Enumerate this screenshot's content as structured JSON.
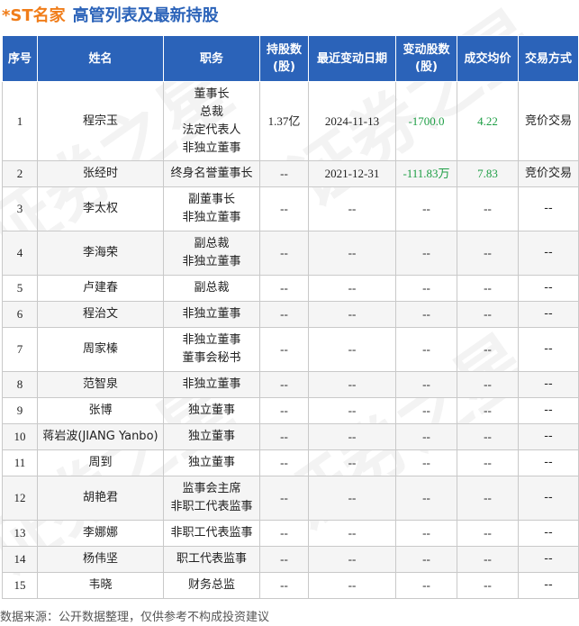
{
  "title": {
    "stock": "*ST名家",
    "main": "高管列表及最新持股"
  },
  "table": {
    "headers": {
      "idx": "序号",
      "name": "姓名",
      "position": "职务",
      "holding_l1": "持股数",
      "holding_l2": "(股)",
      "date": "最近变动日期",
      "change_l1": "变动股数",
      "change_l2": "(股)",
      "avg_price": "成交均价",
      "method": "交易方式"
    },
    "rows": [
      {
        "idx": "1",
        "name": "程宗玉",
        "duties": [
          "董事长",
          "总裁",
          "法定代表人",
          "非独立董事"
        ],
        "holding": "1.37亿",
        "date": "2024-11-13",
        "change": "-1700.0",
        "avg": "4.22",
        "method": "竞价交易"
      },
      {
        "idx": "2",
        "name": "张经时",
        "duties": [
          "终身名誉董事长"
        ],
        "holding": "--",
        "date": "2021-12-31",
        "change": "-111.83万",
        "avg": "7.83",
        "method": "竞价交易"
      },
      {
        "idx": "3",
        "name": "李太权",
        "duties": [
          "副董事长",
          "非独立董事"
        ],
        "holding": "--",
        "date": "--",
        "change": "--",
        "avg": "--",
        "method": "--"
      },
      {
        "idx": "4",
        "name": "李海荣",
        "duties": [
          "副总裁",
          "非独立董事"
        ],
        "holding": "--",
        "date": "--",
        "change": "--",
        "avg": "--",
        "method": "--"
      },
      {
        "idx": "5",
        "name": "卢建春",
        "duties": [
          "副总裁"
        ],
        "holding": "--",
        "date": "--",
        "change": "--",
        "avg": "--",
        "method": "--"
      },
      {
        "idx": "6",
        "name": "程治文",
        "duties": [
          "非独立董事"
        ],
        "holding": "--",
        "date": "--",
        "change": "--",
        "avg": "--",
        "method": "--"
      },
      {
        "idx": "7",
        "name": "周家榛",
        "duties": [
          "非独立董事",
          "董事会秘书"
        ],
        "holding": "--",
        "date": "--",
        "change": "--",
        "avg": "--",
        "method": "--"
      },
      {
        "idx": "8",
        "name": "范智泉",
        "duties": [
          "非独立董事"
        ],
        "holding": "--",
        "date": "--",
        "change": "--",
        "avg": "--",
        "method": "--"
      },
      {
        "idx": "9",
        "name": "张博",
        "duties": [
          "独立董事"
        ],
        "holding": "--",
        "date": "--",
        "change": "--",
        "avg": "--",
        "method": "--"
      },
      {
        "idx": "10",
        "name": "蒋岩波(JIANG Yanbo)",
        "duties": [
          "独立董事"
        ],
        "holding": "--",
        "date": "--",
        "change": "--",
        "avg": "--",
        "method": "--"
      },
      {
        "idx": "11",
        "name": "周到",
        "duties": [
          "独立董事"
        ],
        "holding": "--",
        "date": "--",
        "change": "--",
        "avg": "--",
        "method": "--"
      },
      {
        "idx": "12",
        "name": "胡艳君",
        "duties": [
          "监事会主席",
          "非职工代表监事"
        ],
        "holding": "--",
        "date": "--",
        "change": "--",
        "avg": "--",
        "method": "--"
      },
      {
        "idx": "13",
        "name": "李娜娜",
        "duties": [
          "非职工代表监事"
        ],
        "holding": "--",
        "date": "--",
        "change": "--",
        "avg": "--",
        "method": "--"
      },
      {
        "idx": "14",
        "name": "杨伟坚",
        "duties": [
          "职工代表监事"
        ],
        "holding": "--",
        "date": "--",
        "change": "--",
        "avg": "--",
        "method": "--"
      },
      {
        "idx": "15",
        "name": "韦晓",
        "duties": [
          "财务总监"
        ],
        "holding": "--",
        "date": "--",
        "change": "--",
        "avg": "--",
        "method": "--"
      }
    ]
  },
  "footer": "数据来源：公开数据整理，仅供参考不构成投资建议",
  "watermark": "证券之星",
  "colors": {
    "header_bg": "#2b63b9",
    "title_stock": "#f07d1a",
    "title_main": "#2b63b9",
    "negative_change": "#1e9e45"
  }
}
